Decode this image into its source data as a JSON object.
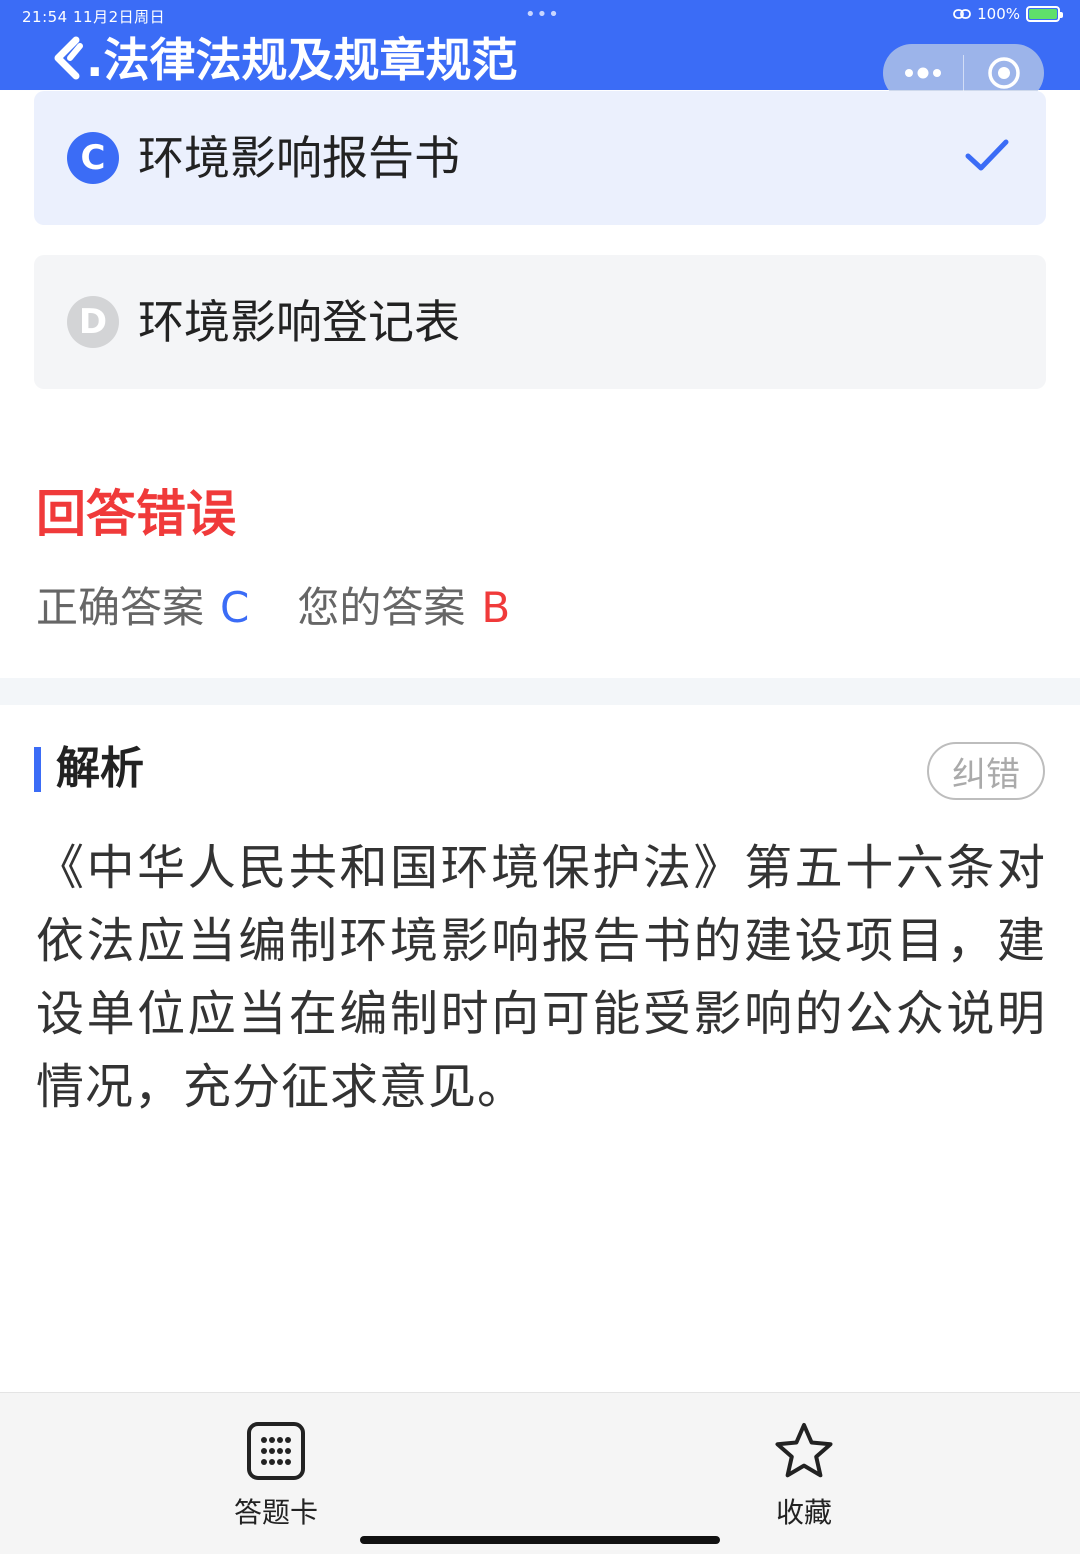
{
  "status_bar": {
    "time": "21:54   11月2日周日",
    "dots": "•••",
    "battery": "100%"
  },
  "header": {
    "title": ".法律法规及规章规范"
  },
  "options": [
    {
      "letter": "C",
      "text": "环境影响报告书",
      "state": "correct-selected"
    },
    {
      "letter": "D",
      "text": "环境影响登记表",
      "state": "unselected"
    }
  ],
  "result": {
    "title": "回答错误",
    "correct_label": "正确答案",
    "correct_answer": "C",
    "your_label": "您的答案",
    "your_answer": "B"
  },
  "analysis": {
    "title": "解析",
    "report_button": "纠错",
    "body": "《中华人民共和国环境保护法》第五十六条对依法应当编制环境影响报告书的建设项目，建设单位应当在编制时向可能受影响的公众说明情况，充分征求意见。"
  },
  "bottom_bar": {
    "answer_card_label": "答题卡",
    "favorite_label": "收藏"
  },
  "colors": {
    "brand": "#3b6cf6",
    "error": "#f03a3a",
    "selected_bg": "#ebf0fd"
  },
  "icons": [
    "back-icon",
    "more-icon",
    "target-icon",
    "check-icon",
    "grid-icon",
    "star-icon",
    "wifi-icon",
    "battery-icon"
  ]
}
